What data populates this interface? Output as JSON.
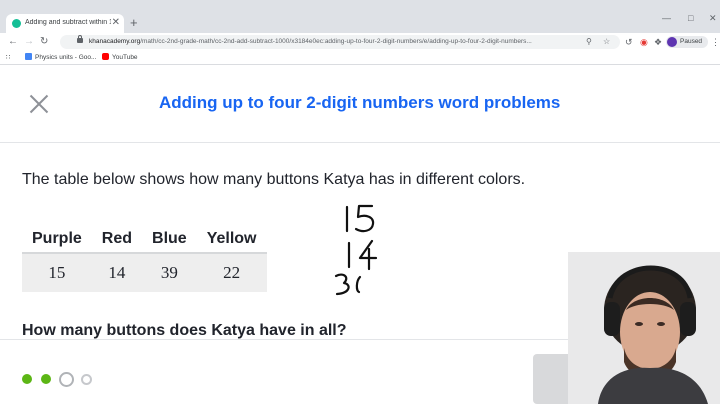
{
  "browser": {
    "tab_title": "Adding and subtract within 1,000 | ...",
    "tab_close": "✕",
    "new_tab": "+",
    "url_host": "khanacademy.org",
    "url_path": "/math/cc-2nd-grade-math/cc-2nd-add-subtract-1000/x3184e0ec:adding-up-to-four-2-digit-numbers/e/adding-up-to-four-2-digit-numbers...",
    "profile_status": "Paused",
    "bookmarks": [
      {
        "label": "Physics units - Goo...",
        "icon": "google-docs-icon"
      },
      {
        "label": "YouTube",
        "icon": "youtube-icon"
      }
    ]
  },
  "exercise": {
    "title": "Adding up to four 2-digit numbers word problems",
    "question": "The table below shows how many buttons Katya has in different colors.",
    "table": {
      "headers": [
        "Purple",
        "Red",
        "Blue",
        "Yellow"
      ],
      "values": [
        "15",
        "14",
        "39",
        "22"
      ]
    },
    "prompt": "How many buttons does Katya have in all?",
    "progress": {
      "total": 4,
      "completed": 2,
      "current_index": 2
    }
  },
  "colors": {
    "title_blue": "#1865f2",
    "progress_green": "#5cb615",
    "text": "#21242c"
  }
}
